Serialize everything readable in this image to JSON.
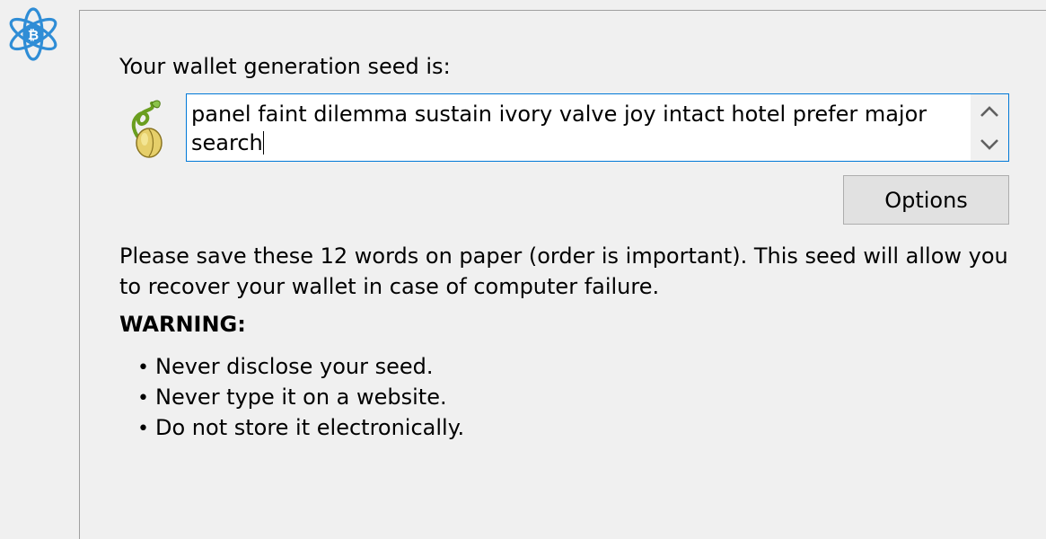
{
  "seed_section": {
    "title": "Your wallet generation seed is:",
    "seed_words": "panel faint dilemma sustain ivory valve joy intact hotel prefer major search",
    "options_label": "Options"
  },
  "info": {
    "message": "Please save these 12 words on paper (order is important). This seed will allow you to recover your wallet in case of computer failure.",
    "warning_heading": "WARNING:",
    "warnings": [
      "Never disclose your seed.",
      "Never type it on a website.",
      "Do not store it electronically."
    ]
  },
  "icons": {
    "app_logo": "electrum-bitcoin-logo-icon",
    "seed": "sprouting-seed-icon",
    "scroll_up": "chevron-up-icon",
    "scroll_down": "chevron-down-icon"
  },
  "colors": {
    "logo_blue": "#2f8dd6",
    "focus_border": "#0078d7",
    "button_bg": "#e1e1e1"
  }
}
